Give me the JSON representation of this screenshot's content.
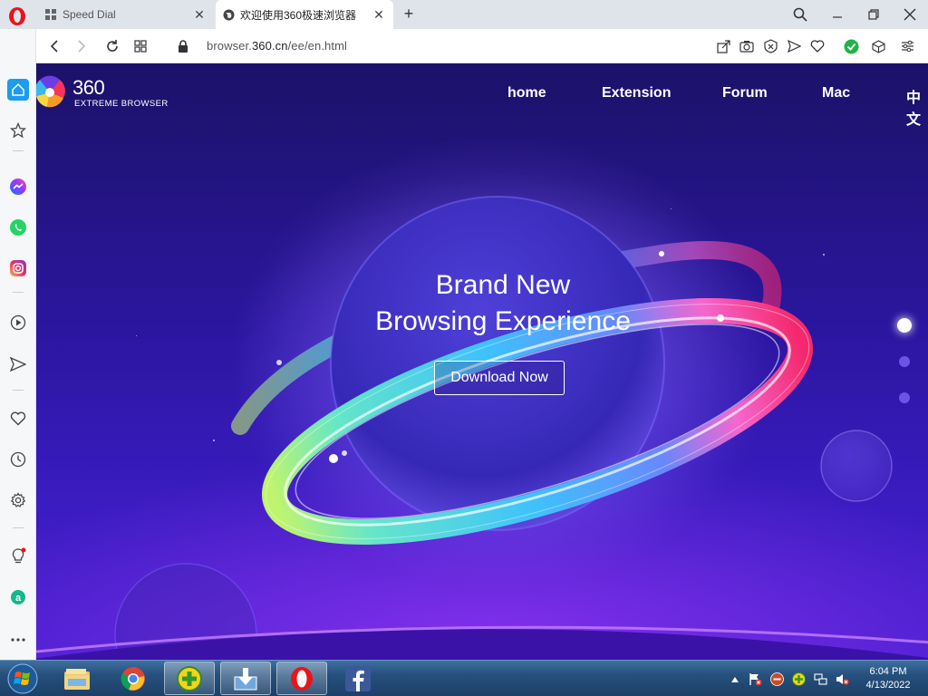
{
  "browser": {
    "tabs": [
      {
        "label": "Speed Dial",
        "active": false,
        "icon": "speed-dial-icon"
      },
      {
        "label": "欢迎使用360极速浏览器",
        "active": true,
        "icon": "globe-icon"
      }
    ],
    "address": {
      "prefix": "browser.",
      "domain": "360.cn",
      "path": "/ee/en.html"
    }
  },
  "sidebar": {
    "items": [
      "home-icon",
      "speed-dial-star-icon",
      "messenger-icon",
      "whatsapp-icon",
      "instagram-icon",
      "player-icon",
      "flow-send-icon",
      "heart-icon",
      "history-clock-icon",
      "settings-gear-icon",
      "lightbulb-tips-icon",
      "aria-assistant-icon",
      "more-dots-icon"
    ]
  },
  "site": {
    "logo_number": "360",
    "logo_subtitle": "EXTREME BROWSER",
    "nav": [
      "home",
      "Extension",
      "Forum",
      "Mac",
      "中文"
    ],
    "hero_line1": "Brand New",
    "hero_line2": "Browsing Experience",
    "download_label": "Download Now"
  },
  "taskbar": {
    "apps": [
      "windows-explorer-icon",
      "chrome-icon",
      "360-browser-icon",
      "download-installer-icon",
      "opera-icon",
      "facebook-icon"
    ],
    "time": "6:04 PM",
    "date": "4/13/2022"
  },
  "colors": {
    "accent_opera": "#e8141a",
    "page_bg_top": "#1c1268",
    "page_bg_bottom": "#4a1fd0",
    "taskbar": "#26507c"
  }
}
